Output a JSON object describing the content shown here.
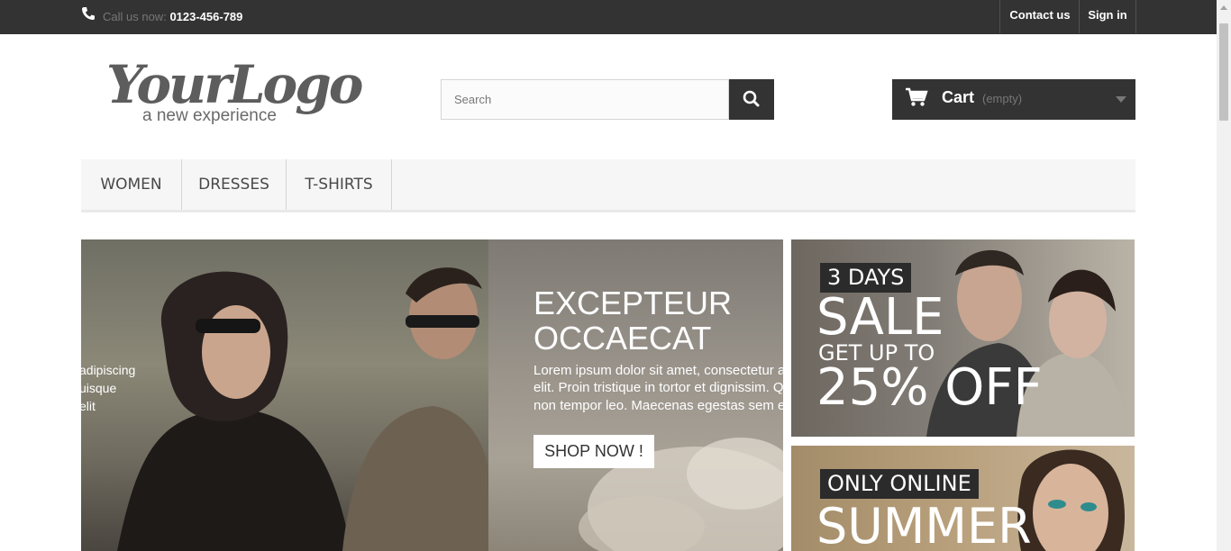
{
  "topbar": {
    "call_label": "Call us now:",
    "phone": "0123-456-789",
    "contact": "Contact us",
    "signin": "Sign in"
  },
  "logo": {
    "main": "YourLogo",
    "tagline": "a new experience"
  },
  "search": {
    "placeholder": "Search"
  },
  "cart": {
    "label": "Cart",
    "status": "(empty)"
  },
  "nav": {
    "items": [
      "WOMEN",
      "DRESSES",
      "T-SHIRTS"
    ]
  },
  "slider": {
    "prev_slide_lines": [
      "adipiscing",
      "uisque",
      "elit"
    ],
    "title_lines": [
      "EXCEPTEUR",
      "OCCAECAT"
    ],
    "text_lines": [
      "Lorem ipsum dolor sit amet, consectetur a",
      "elit. Proin tristique in tortor et dignissim. Q",
      "non tempor leo. Maecenas egestas sem e"
    ],
    "button": "SHOP NOW !"
  },
  "banner1": {
    "tag": "3 DAYS",
    "big": "SALE",
    "sub": "GET UP TO",
    "offer": "25% OFF"
  },
  "banner2": {
    "tag": "ONLY ONLINE",
    "big": "SUMMER"
  },
  "colors": {
    "dark": "#333333",
    "nav_bg": "#f6f6f6",
    "muted": "#777777"
  }
}
